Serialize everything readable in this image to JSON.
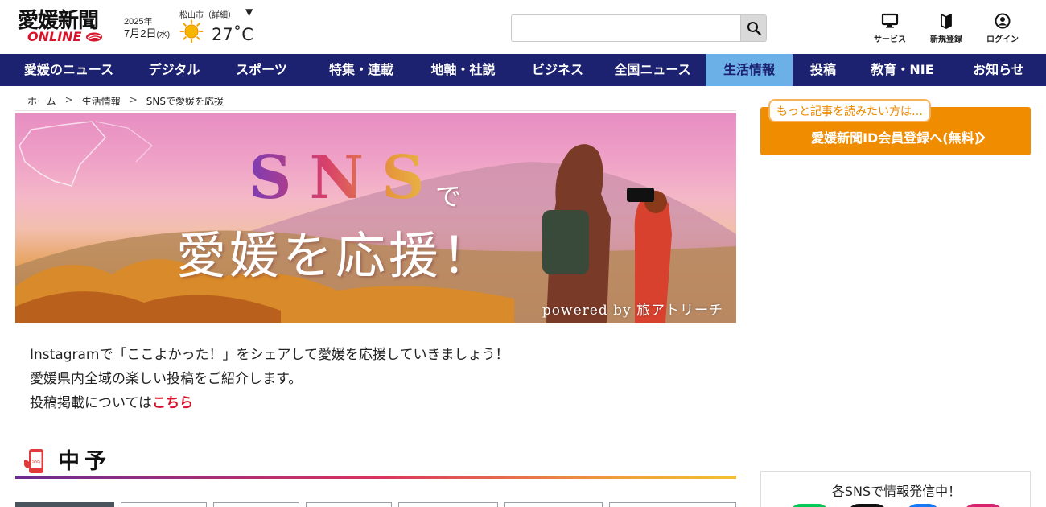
{
  "header": {
    "logo_text": "愛媛新聞",
    "logo_sub": "ONLINE",
    "date_year": "2025年",
    "date_month_day": "7月2日",
    "date_weekday": "(水)",
    "weather_city": "松山市（詳細）",
    "weather_dropdown_glyph": "▼",
    "weather_icon": "sun-icon",
    "temperature": "27˚C",
    "search": {
      "placeholder": "",
      "value": "",
      "button_icon": "search-icon"
    },
    "actions": [
      {
        "label": "サービス",
        "icon": "monitor-icon"
      },
      {
        "label": "新規登録",
        "icon": "beginner-mark-icon"
      },
      {
        "label": "ログイン",
        "icon": "user-icon"
      }
    ]
  },
  "nav": {
    "items": [
      {
        "label": "愛媛のニュース"
      },
      {
        "label": "デジタル"
      },
      {
        "label": "スポーツ"
      },
      {
        "label": "特集・連載"
      },
      {
        "label": "地軸・社説"
      },
      {
        "label": "ビジネス"
      },
      {
        "label": "全国ニュース"
      },
      {
        "label": "生活情報",
        "active": true
      },
      {
        "label": "投稿"
      },
      {
        "label": "教育・NIE"
      },
      {
        "label": "お知らせ"
      }
    ],
    "active_color": "#6cb0e8",
    "bar_color": "#1c2270"
  },
  "breadcrumb": {
    "items": [
      "ホーム",
      "生活情報",
      "SNSで愛媛を応援"
    ],
    "separator": ">"
  },
  "banner": {
    "sns": "SNS",
    "de": "で",
    "tagline": "愛媛を応援！",
    "credit": "powered by 旅アトリーチ"
  },
  "intro": {
    "line1": "Instagramで「ここよかった！」をシェアして愛媛を応援していきましょう！",
    "line2": "愛媛県内全域の楽しい投稿をご紹介します。",
    "line3_prefix": "投稿掲載については",
    "line3_link": "こちら"
  },
  "section": {
    "title": "中予",
    "icon": "smartphone-sns-icon"
  },
  "sidebar": {
    "cta_bubble": "もっと記事を読みたい方は…",
    "cta_label": "愛媛新聞ID会員登録へ(無料)",
    "cta_color": "#f08c00",
    "sns_title": "各SNSで情報発信中！",
    "sns_icons": [
      "line-icon",
      "x-icon",
      "facebook-icon",
      "instagram-icon"
    ]
  }
}
